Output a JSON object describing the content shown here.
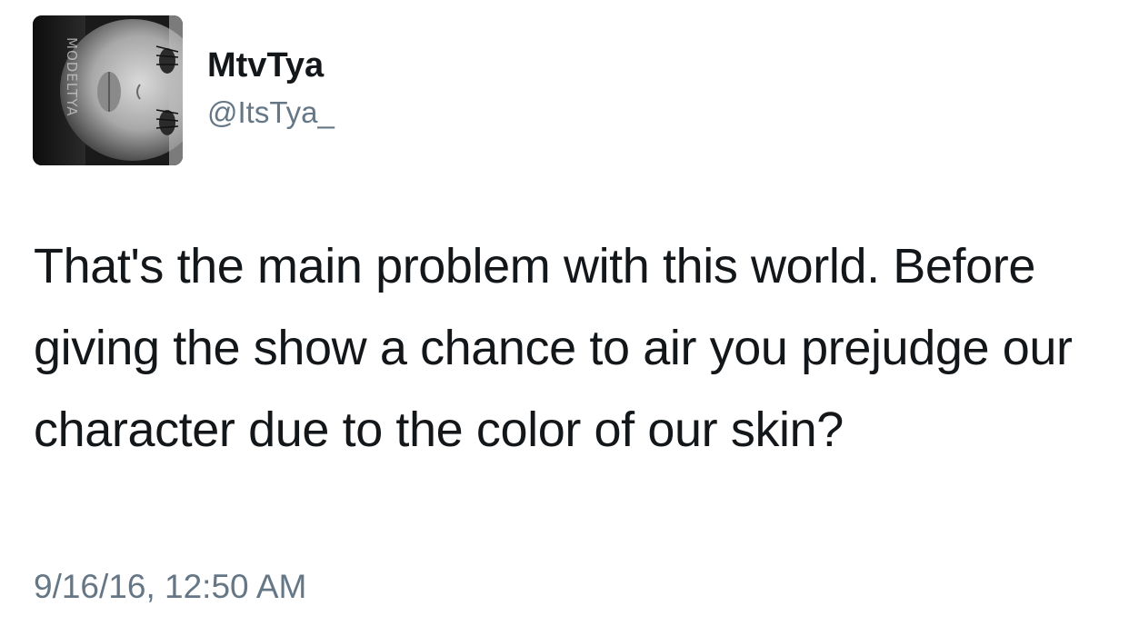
{
  "tweet": {
    "author": {
      "display_name": "MtvTya",
      "handle": "@ItsTya_",
      "avatar": {
        "icon": "profile-photo",
        "watermark": "MODELTYA"
      }
    },
    "text": "That's the main problem with this world. Before giving the show a chance to air you prejudge our character due to the color of our skin?",
    "timestamp": "9/16/16, 12:50 AM"
  },
  "colors": {
    "text_primary": "#14171a",
    "text_secondary": "#657786",
    "background": "#ffffff"
  }
}
